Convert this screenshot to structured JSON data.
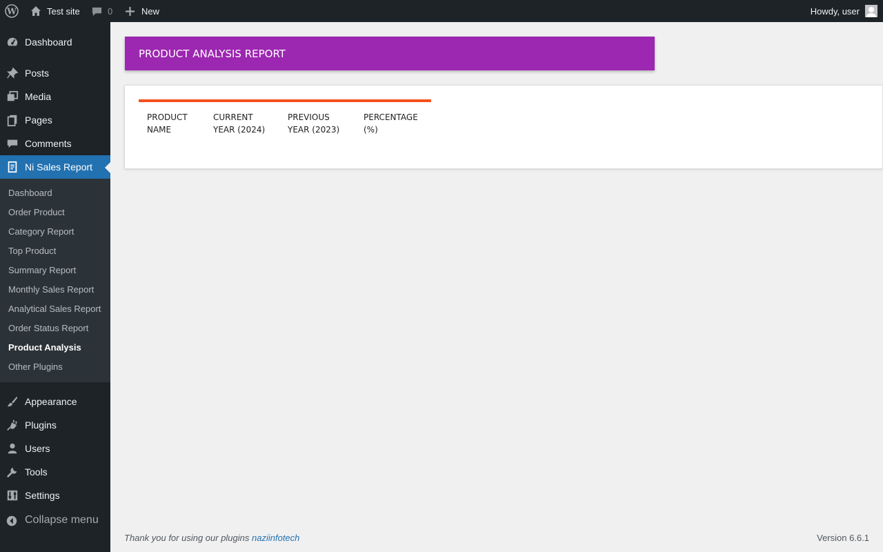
{
  "adminbar": {
    "site_name": "Test site",
    "comments_count": "0",
    "new_label": "New",
    "howdy": "Howdy, user"
  },
  "sidebar": {
    "top_items": [
      {
        "label": "Dashboard",
        "icon": "dashboard-icon"
      },
      {
        "label": "Posts",
        "icon": "pin-icon"
      },
      {
        "label": "Media",
        "icon": "media-icon"
      },
      {
        "label": "Pages",
        "icon": "pages-icon"
      },
      {
        "label": "Comments",
        "icon": "comments-icon"
      },
      {
        "label": "Ni Sales Report",
        "icon": "report-icon"
      }
    ],
    "submenu": [
      "Dashboard",
      "Order Product",
      "Category Report",
      "Top Product",
      "Summary Report",
      "Monthly Sales Report",
      "Analytical Sales Report",
      "Order Status Report",
      "Product Analysis",
      "Other Plugins"
    ],
    "bottom_items": [
      {
        "label": "Appearance",
        "icon": "brush-icon"
      },
      {
        "label": "Plugins",
        "icon": "plugin-icon"
      },
      {
        "label": "Users",
        "icon": "user-icon"
      },
      {
        "label": "Tools",
        "icon": "wrench-icon"
      },
      {
        "label": "Settings",
        "icon": "settings-icon"
      }
    ],
    "collapse_label": "Collapse menu",
    "accent_color": "#2271b1"
  },
  "main": {
    "banner_title": "PRODUCT ANALYSIS REPORT",
    "banner_color": "#9c27b0",
    "rule_color": "#f4511e",
    "table_headers": [
      {
        "line1": "PRODUCT",
        "line2": "NAME"
      },
      {
        "line1": "CURRENT",
        "line2": "YEAR (2024)"
      },
      {
        "line1": "PREVIOUS",
        "line2": "YEAR (2023)"
      },
      {
        "line1": "PERCENTAGE",
        "line2": "(%)"
      }
    ]
  },
  "footer": {
    "thanks_text": "Thank you for using our plugins",
    "link_text": "naziinfotech",
    "version": "Version 6.6.1"
  }
}
